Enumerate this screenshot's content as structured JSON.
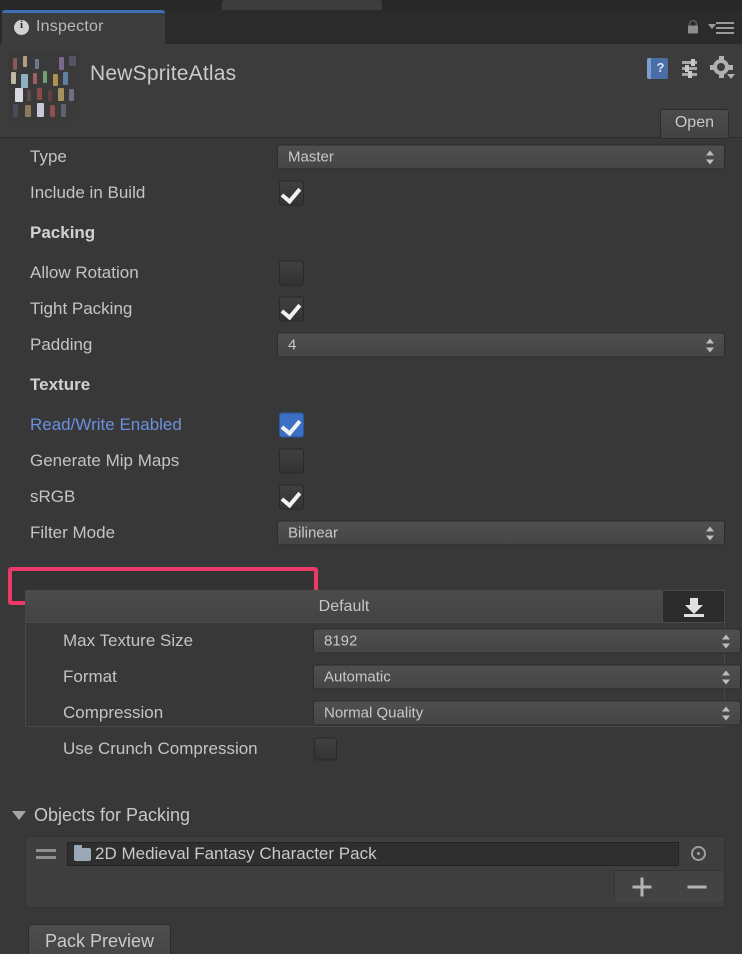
{
  "window": {
    "tab_label": "Inspector",
    "tab_icon": "info-icon",
    "lock_icon": "lock-icon",
    "menu_icon": "hamburger-menu-icon",
    "accent_color": "#3f6fb5",
    "background_color": "#383838"
  },
  "asset_header": {
    "title": "NewSpriteAtlas",
    "thumbnail_icon": "sprite-atlas-thumbnail",
    "help_icon": "help-book-icon",
    "preset_icon": "preset-sliders-icon",
    "gear_icon": "gear-icon",
    "open_label": "Open"
  },
  "inspector": {
    "type": {
      "label": "Type",
      "value": "Master"
    },
    "include_in_build": {
      "label": "Include in Build",
      "checked": true
    },
    "packing_section": "Packing",
    "allow_rotation": {
      "label": "Allow Rotation",
      "checked": false
    },
    "tight_packing": {
      "label": "Tight Packing",
      "checked": true
    },
    "padding": {
      "label": "Padding",
      "value": "4"
    },
    "texture_section": "Texture",
    "read_write_enabled": {
      "label": "Read/Write Enabled",
      "checked": true,
      "highlighted": true,
      "highlight_color": "#ec3a68",
      "label_color": "#6d8fe0"
    },
    "generate_mip_maps": {
      "label": "Generate Mip Maps",
      "checked": false
    },
    "srgb": {
      "label": "sRGB",
      "checked": true
    },
    "filter_mode": {
      "label": "Filter Mode",
      "value": "Bilinear"
    }
  },
  "platform": {
    "tab_label": "Default",
    "download_icon": "download-override-icon",
    "max_texture_size": {
      "label": "Max Texture Size",
      "value": "8192"
    },
    "format": {
      "label": "Format",
      "value": "Automatic"
    },
    "compression": {
      "label": "Compression",
      "value": "Normal Quality"
    },
    "use_crunch_compression": {
      "label": "Use Crunch Compression",
      "checked": false
    }
  },
  "objects_for_packing": {
    "foldout_label": "Objects for Packing",
    "expanded": true,
    "drag_handle_icon": "drag-handle-icon",
    "folder_icon": "folder-icon",
    "picker_icon": "object-picker-icon",
    "entry_name": "2D Medieval Fantasy Character Pack",
    "add_label": "+",
    "remove_label": "−"
  },
  "footer": {
    "pack_preview_label": "Pack Preview"
  }
}
